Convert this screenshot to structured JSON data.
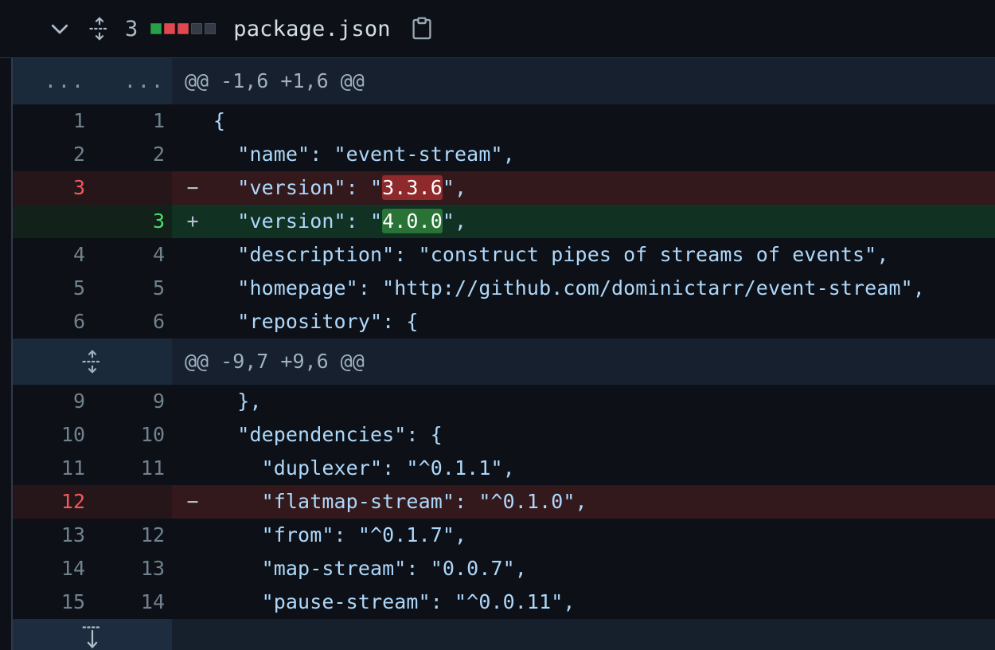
{
  "header": {
    "collapse_icon": "chevron-down-icon",
    "expand_icon": "expand-all-icon",
    "change_count": "3",
    "diffstat_squares": [
      "add",
      "del",
      "del",
      "neutral",
      "neutral"
    ],
    "file_name": "package.json",
    "copy_icon": "copy-path-icon"
  },
  "colors": {
    "page_bg": "#0d1117",
    "code_text": "#aed8fb",
    "line_number": "#72818f",
    "add_line_bg": "#113123",
    "del_line_bg": "#33191c",
    "add_word_bg": "#2a7337",
    "del_word_bg": "#8f2a2c",
    "add_number": "#4ade6c",
    "del_number": "#f4595f",
    "hunk_gutter_bg": "#1b2a3b",
    "hunk_code_bg": "#16202e",
    "diffstat_add": "#26a148",
    "diffstat_del": "#e04850",
    "diffstat_neutral": "#343b47"
  },
  "rows": [
    {
      "kind": "hunk",
      "gutter_style": "dots",
      "old_num": "...",
      "new_num": "...",
      "text": "@@ -1,6 +1,6 @@"
    },
    {
      "kind": "context",
      "old_num": "1",
      "new_num": "1",
      "marker": "",
      "text": "{"
    },
    {
      "kind": "context",
      "old_num": "2",
      "new_num": "2",
      "marker": "",
      "text": "  \"name\": \"event-stream\","
    },
    {
      "kind": "del",
      "old_num": "3",
      "new_num": "",
      "marker": "−",
      "text_before": "  \"version\": \"",
      "highlight": "3.3.6",
      "text_after": "\","
    },
    {
      "kind": "add",
      "old_num": "",
      "new_num": "3",
      "marker": "+",
      "text_before": "  \"version\": \"",
      "highlight": "4.0.0",
      "text_after": "\","
    },
    {
      "kind": "context",
      "old_num": "4",
      "new_num": "4",
      "marker": "",
      "text": "  \"description\": \"construct pipes of streams of events\","
    },
    {
      "kind": "context",
      "old_num": "5",
      "new_num": "5",
      "marker": "",
      "text": "  \"homepage\": \"http://github.com/dominictarr/event-stream\","
    },
    {
      "kind": "context",
      "old_num": "6",
      "new_num": "6",
      "marker": "",
      "text": "  \"repository\": {"
    },
    {
      "kind": "hunk",
      "gutter_style": "expand-icon",
      "old_num": "",
      "new_num": "",
      "text": "@@ -9,7 +9,6 @@"
    },
    {
      "kind": "context",
      "old_num": "9",
      "new_num": "9",
      "marker": "",
      "text": "  },"
    },
    {
      "kind": "context",
      "old_num": "10",
      "new_num": "10",
      "marker": "",
      "text": "  \"dependencies\": {"
    },
    {
      "kind": "context",
      "old_num": "11",
      "new_num": "11",
      "marker": "",
      "text": "    \"duplexer\": \"^0.1.1\","
    },
    {
      "kind": "del",
      "old_num": "12",
      "new_num": "",
      "marker": "−",
      "text": "    \"flatmap-stream\": \"^0.1.0\","
    },
    {
      "kind": "context",
      "old_num": "13",
      "new_num": "12",
      "marker": "",
      "text": "    \"from\": \"^0.1.7\","
    },
    {
      "kind": "context",
      "old_num": "14",
      "new_num": "13",
      "marker": "",
      "text": "    \"map-stream\": \"0.0.7\","
    },
    {
      "kind": "context",
      "old_num": "15",
      "new_num": "14",
      "marker": "",
      "text": "    \"pause-stream\": \"^0.0.11\","
    },
    {
      "kind": "expand-down",
      "icon": "expand-down-icon"
    }
  ]
}
